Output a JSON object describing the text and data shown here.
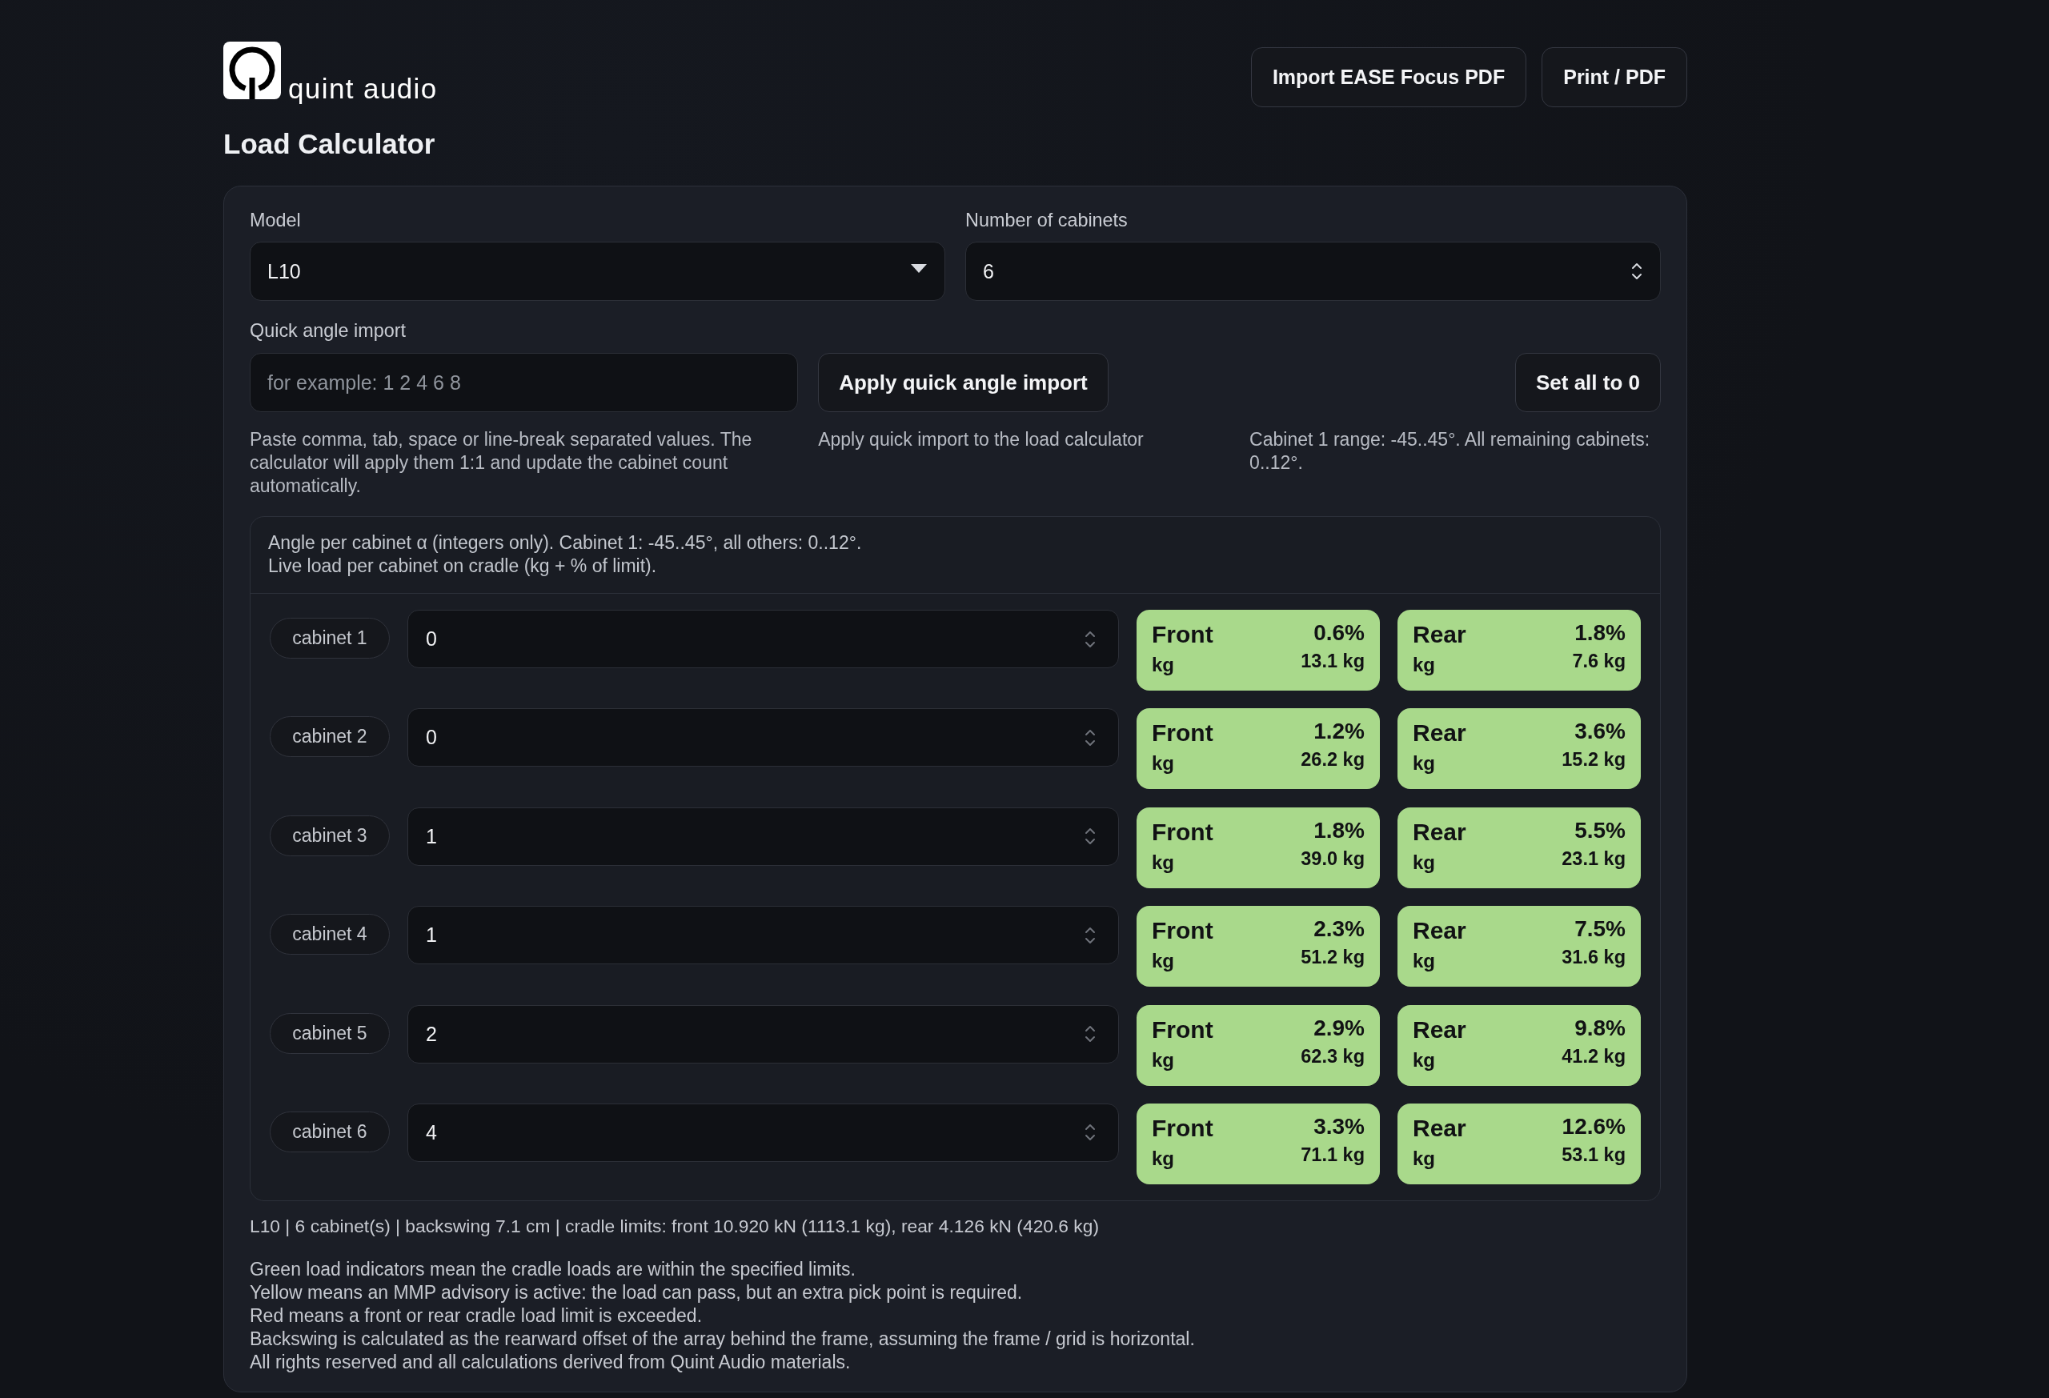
{
  "brand": {
    "name": "quint audio"
  },
  "import_button": "Import EASE Focus PDF",
  "print_button": "Print / PDF",
  "title": "Load Calculator",
  "model": {
    "label": "Model",
    "value": "L10"
  },
  "cabinet_count": {
    "label": "Number of cabinets",
    "value": "6"
  },
  "quick_import": {
    "label": "Quick angle import",
    "placeholder": "for example: 1 2 4 6 8",
    "help": "Paste comma, tab, space or line-break separated values. The calculator will apply them 1:1 and update the cabinet count automatically.",
    "apply_button": "Apply quick angle import",
    "apply_hint": "Apply quick import to the load calculator",
    "reset_button": "Set all to 0",
    "range_hint": "Cabinet 1 range: -45..45°. All remaining cabinets: 0..12°."
  },
  "cabinets": {
    "intro": [
      "Angle per cabinet α (integers only). Cabinet 1: -45..45°, all others: 0..12°.",
      "Live load per cabinet on cradle (kg + % of limit)."
    ],
    "rows": [
      {
        "name": "cabinet 1",
        "angle": "0",
        "loads": [
          {
            "label": "Front",
            "unit": "kg",
            "percent": "0.6%",
            "weight": "13.1 kg",
            "color": "#a9d98b"
          },
          {
            "label": "Rear",
            "unit": "kg",
            "percent": "1.8%",
            "weight": "7.6 kg",
            "color": "#a9d98b"
          }
        ]
      },
      {
        "name": "cabinet 2",
        "angle": "0",
        "loads": [
          {
            "label": "Front",
            "unit": "kg",
            "percent": "1.2%",
            "weight": "26.2 kg",
            "color": "#a9d98b"
          },
          {
            "label": "Rear",
            "unit": "kg",
            "percent": "3.6%",
            "weight": "15.2 kg",
            "color": "#a9d98b"
          }
        ]
      },
      {
        "name": "cabinet 3",
        "angle": "1",
        "loads": [
          {
            "label": "Front",
            "unit": "kg",
            "percent": "1.8%",
            "weight": "39.0 kg",
            "color": "#a9d98b"
          },
          {
            "label": "Rear",
            "unit": "kg",
            "percent": "5.5%",
            "weight": "23.1 kg",
            "color": "#a9d98b"
          }
        ]
      },
      {
        "name": "cabinet 4",
        "angle": "1",
        "loads": [
          {
            "label": "Front",
            "unit": "kg",
            "percent": "2.3%",
            "weight": "51.2 kg",
            "color": "#a9d98b"
          },
          {
            "label": "Rear",
            "unit": "kg",
            "percent": "7.5%",
            "weight": "31.6 kg",
            "color": "#a9d98b"
          }
        ]
      },
      {
        "name": "cabinet 5",
        "angle": "2",
        "loads": [
          {
            "label": "Front",
            "unit": "kg",
            "percent": "2.9%",
            "weight": "62.3 kg",
            "color": "#a9d98b"
          },
          {
            "label": "Rear",
            "unit": "kg",
            "percent": "9.8%",
            "weight": "41.2 kg",
            "color": "#a9d98b"
          }
        ]
      },
      {
        "name": "cabinet 6",
        "angle": "4",
        "loads": [
          {
            "label": "Front",
            "unit": "kg",
            "percent": "3.3%",
            "weight": "71.1 kg",
            "color": "#a9d98b"
          },
          {
            "label": "Rear",
            "unit": "kg",
            "percent": "12.6%",
            "weight": "53.1 kg",
            "color": "#a9d98b"
          }
        ]
      }
    ]
  },
  "summary": "L10 | 6 cabinet(s) | backswing 7.1 cm | cradle limits: front 10.920 kN (1113.1 kg), rear 4.126 kN (420.6 kg)",
  "notes": [
    "Green load indicators mean the cradle loads are within the specified limits.",
    "Yellow means an MMP advisory is active: the load can pass, but an extra pick point is required.",
    "Red means a front or rear cradle load limit is exceeded.",
    "Backswing is calculated as the rearward offset of the array behind the frame, assuming the frame / grid is horizontal.",
    "All rights reserved and all calculations derived from Quint Audio materials."
  ]
}
